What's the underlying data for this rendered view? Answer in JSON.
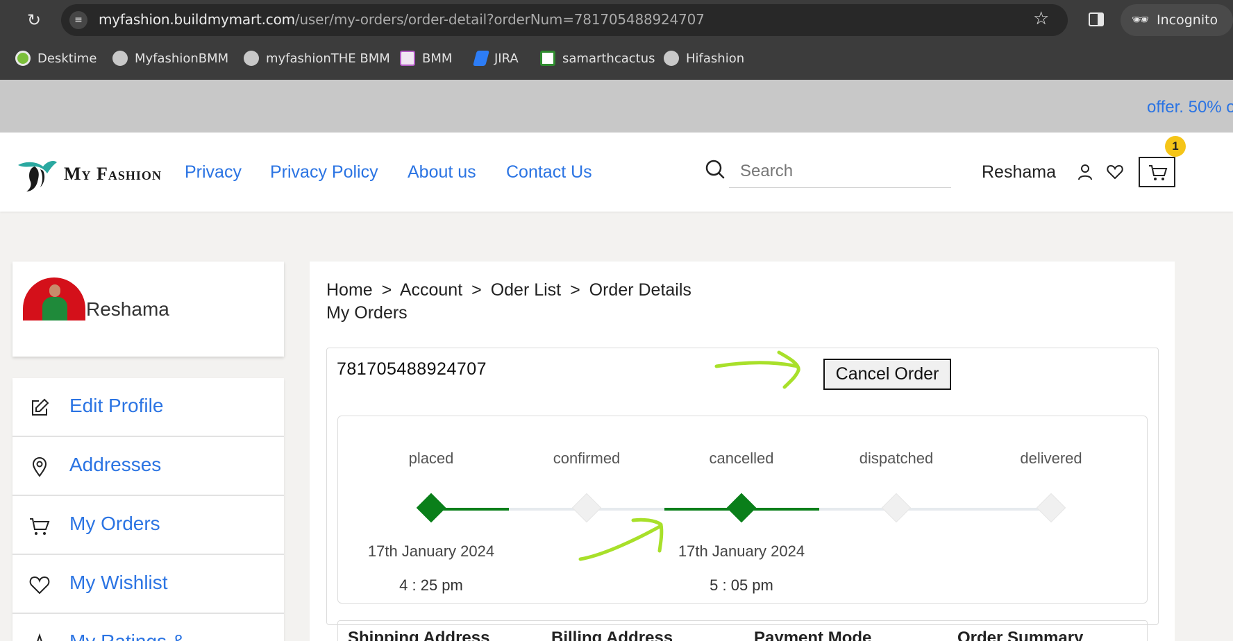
{
  "browser": {
    "url_host": "myfashion.buildmymart.com",
    "url_path": "/user/my-orders/order-detail?orderNum=781705488924707",
    "incognito_label": "Incognito",
    "bookmarks": [
      {
        "label": "Desktime",
        "icon": "desktime-icon"
      },
      {
        "label": "MyfashionBMM",
        "icon": "globe-icon"
      },
      {
        "label": "myfashionTHE BMM",
        "icon": "globe-icon"
      },
      {
        "label": "BMM",
        "icon": "bmm-icon"
      },
      {
        "label": "JIRA",
        "icon": "jira-icon"
      },
      {
        "label": "samarthcactus",
        "icon": "cactus-icon"
      },
      {
        "label": "Hifashion",
        "icon": "globe-icon"
      }
    ]
  },
  "promo": {
    "text": "offer. 50% o"
  },
  "header": {
    "brand": "My Fashion",
    "nav": [
      "Privacy",
      "Privacy Policy",
      "About us",
      "Contact Us"
    ],
    "search_placeholder": "Search",
    "user_name": "Reshama",
    "cart_count": "1"
  },
  "sidebar": {
    "profile_name": "Reshama",
    "items": [
      {
        "label": "Edit Profile",
        "icon": "edit-icon"
      },
      {
        "label": "Addresses",
        "icon": "location-pin-icon"
      },
      {
        "label": "My Orders",
        "icon": "cart-icon"
      },
      {
        "label": "My Wishlist",
        "icon": "heart-icon"
      },
      {
        "label": "My Ratings &",
        "icon": "star-icon"
      }
    ]
  },
  "main": {
    "breadcrumb": [
      "Home",
      ">",
      "Account",
      ">",
      "Oder List",
      ">",
      "Order Details"
    ],
    "title": "My Orders",
    "order_number": "781705488924707",
    "cancel_label": "Cancel Order",
    "tracker": [
      {
        "label": "placed",
        "date": "17th January 2024",
        "time": "4 : 25 pm",
        "active": true
      },
      {
        "label": "confirmed",
        "date": "",
        "time": "",
        "active": false
      },
      {
        "label": "cancelled",
        "date": "17th January 2024",
        "time": "5 : 05 pm",
        "active": true
      },
      {
        "label": "dispatched",
        "date": "",
        "time": "",
        "active": false
      },
      {
        "label": "delivered",
        "date": "",
        "time": "",
        "active": false
      }
    ],
    "detail_headers": [
      "Shipping Address",
      "Billing Address",
      "Payment Mode",
      "Order Summary"
    ]
  },
  "colors": {
    "link": "#2b74e3",
    "active_step": "#0a7f1a",
    "annotation": "#a8e02a",
    "badge": "#f5c518"
  }
}
